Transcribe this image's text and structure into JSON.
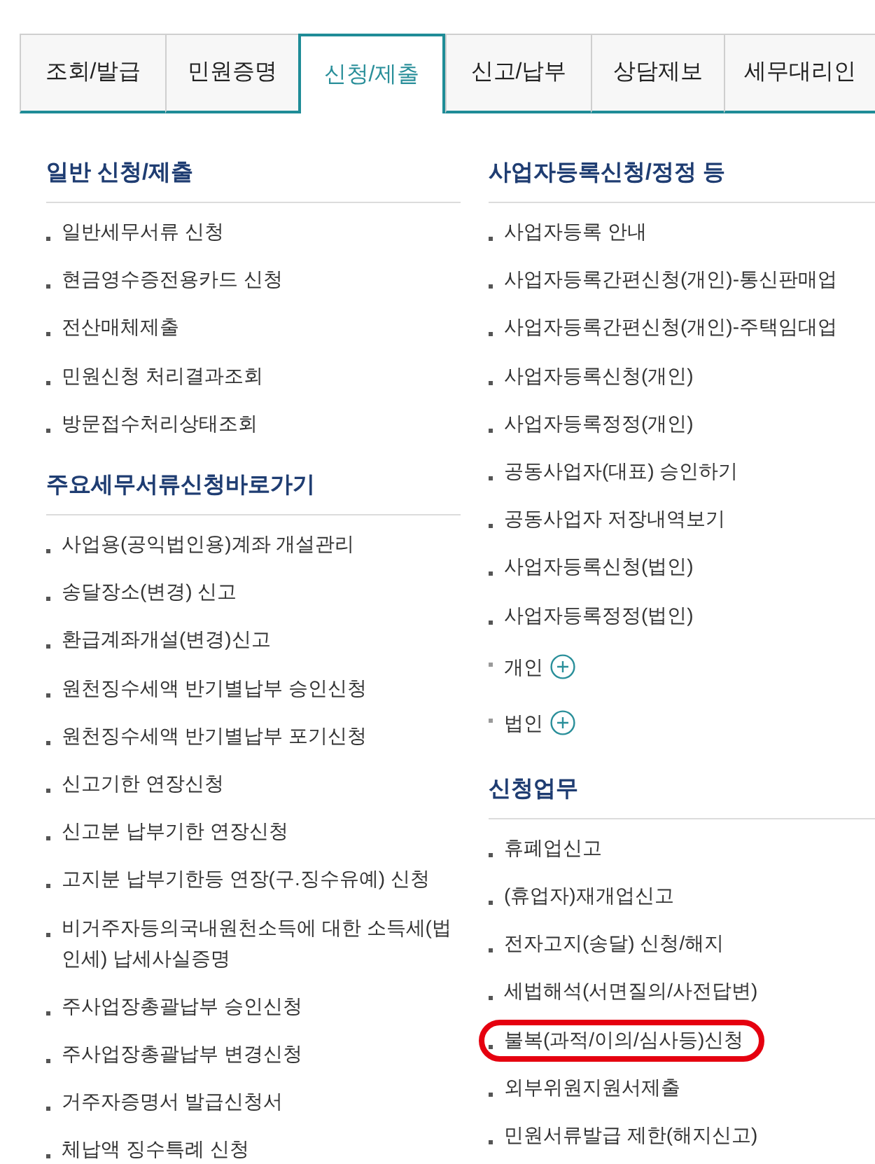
{
  "tabs": [
    {
      "label": "조회/발급",
      "selected": false
    },
    {
      "label": "민원증명",
      "selected": false
    },
    {
      "label": "신청/제출",
      "selected": true
    },
    {
      "label": "신고/납부",
      "selected": false
    },
    {
      "label": "상담제보",
      "selected": false
    },
    {
      "label": "세무대리인",
      "selected": false
    }
  ],
  "columns": [
    {
      "sections": [
        {
          "title": "일반 신청/제출",
          "items": [
            {
              "label": "일반세무서류 신청"
            },
            {
              "label": "현금영수증전용카드 신청"
            },
            {
              "label": "전산매체제출"
            },
            {
              "label": "민원신청 처리결과조회"
            },
            {
              "label": "방문접수처리상태조회"
            }
          ]
        },
        {
          "title": "주요세무서류신청바로가기",
          "items": [
            {
              "label": "사업용(공익법인용)계좌 개설관리"
            },
            {
              "label": "송달장소(변경) 신고"
            },
            {
              "label": "환급계좌개설(변경)신고"
            },
            {
              "label": "원천징수세액 반기별납부 승인신청"
            },
            {
              "label": "원천징수세액 반기별납부 포기신청"
            },
            {
              "label": "신고기한 연장신청"
            },
            {
              "label": "신고분 납부기한 연장신청"
            },
            {
              "label": "고지분 납부기한등 연장(구.징수유예) 신청"
            },
            {
              "label": "비거주자등의국내원천소득에 대한 소득세(법인세) 납세사실증명"
            },
            {
              "label": "주사업장총괄납부 승인신청"
            },
            {
              "label": "주사업장총괄납부 변경신청"
            },
            {
              "label": "거주자증명서 발급신청서"
            },
            {
              "label": "체납액 징수특례 신청"
            }
          ]
        }
      ]
    },
    {
      "sections": [
        {
          "title": "사업자등록신청/정정 등",
          "items": [
            {
              "label": "사업자등록 안내",
              "kind": "link"
            },
            {
              "label": "사업자등록간편신청(개인)-통신판매업",
              "kind": "link"
            },
            {
              "label": "사업자등록간편신청(개인)-주택임대업",
              "kind": "link"
            },
            {
              "label": "사업자등록신청(개인)",
              "kind": "link"
            },
            {
              "label": "사업자등록정정(개인)",
              "kind": "link"
            },
            {
              "label": "공동사업자(대표) 승인하기",
              "kind": "link"
            },
            {
              "label": "공동사업자 저장내역보기",
              "kind": "link"
            },
            {
              "label": "사업자등록신청(법인)",
              "kind": "link"
            },
            {
              "label": "사업자등록정정(법인)",
              "kind": "link"
            },
            {
              "label": "개인",
              "kind": "expand"
            },
            {
              "label": "법인",
              "kind": "expand"
            }
          ]
        },
        {
          "title": "신청업무",
          "items": [
            {
              "label": "휴폐업신고",
              "circled": false
            },
            {
              "label": "(휴업자)재개업신고",
              "circled": false
            },
            {
              "label": "전자고지(송달) 신청/해지",
              "circled": false
            },
            {
              "label": "세법해석(서면질의/사전답변)",
              "circled": false
            },
            {
              "label": "불복(과적/이의/심사등)신청",
              "circled": true
            },
            {
              "label": "외부위원지원서제출",
              "circled": false
            },
            {
              "label": "민원서류발급 제한(해지신고)",
              "circled": false
            }
          ]
        }
      ]
    }
  ]
}
